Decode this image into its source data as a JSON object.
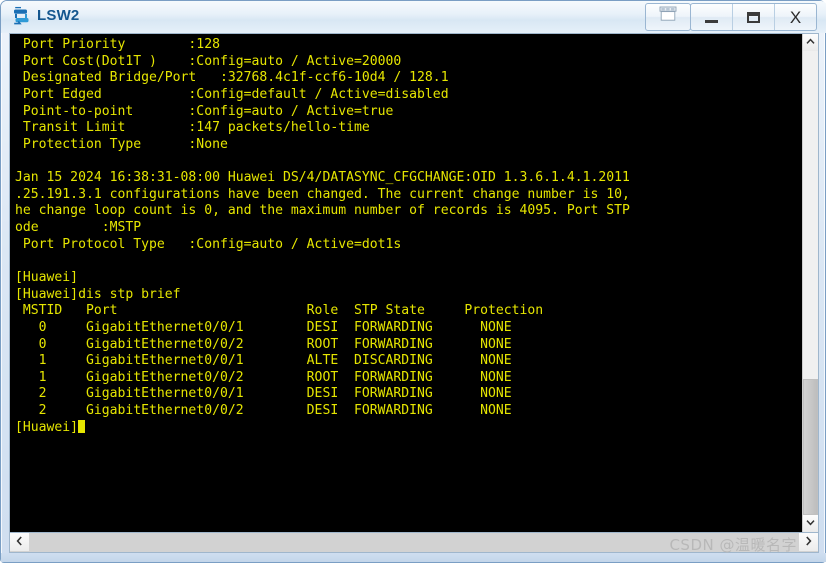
{
  "window": {
    "title": "LSW2",
    "app_icon": "switch-icon",
    "buttons": {
      "extra": {
        "label": "",
        "icon": "restore-windows-icon"
      },
      "minimize": {
        "label": "",
        "icon": "minimize-icon"
      },
      "maximize": {
        "label": "",
        "icon": "maximize-icon"
      },
      "close": {
        "label": "X",
        "icon": "close-icon"
      }
    }
  },
  "terminal": {
    "foreground_color": "#e6e600",
    "background_color": "#000000",
    "lines": [
      " Port Priority        :128",
      " Port Cost(Dot1T )    :Config=auto / Active=20000",
      " Designated Bridge/Port   :32768.4c1f-ccf6-10d4 / 128.1",
      " Port Edged           :Config=default / Active=disabled",
      " Point-to-point       :Config=auto / Active=true",
      " Transit Limit        :147 packets/hello-time",
      " Protection Type      :None",
      "",
      "Jan 15 2024 16:38:31-08:00 Huawei DS/4/DATASYNC_CFGCHANGE:OID 1.3.6.1.4.1.2011",
      ".25.191.3.1 configurations have been changed. The current change number is 10,",
      "he change loop count is 0, and the maximum number of records is 4095. Port STP",
      "ode        :MSTP",
      " Port Protocol Type   :Config=auto / Active=dot1s",
      "",
      "[Huawei]",
      "[Huawei]dis stp brief",
      " MSTID   Port                        Role  STP State     Protection",
      "   0     GigabitEthernet0/0/1        DESI  FORWARDING      NONE",
      "   0     GigabitEthernet0/0/2        ROOT  FORWARDING      NONE",
      "   1     GigabitEthernet0/0/1        ALTE  DISCARDING      NONE",
      "   1     GigabitEthernet0/0/2        ROOT  FORWARDING      NONE",
      "   2     GigabitEthernet0/0/1        DESI  FORWARDING      NONE",
      "   2     GigabitEthernet0/0/2        DESI  FORWARDING      NONE"
    ],
    "prompt": "[Huawei]"
  },
  "stp_brief": {
    "command": "dis stp brief",
    "columns": [
      "MSTID",
      "Port",
      "Role",
      "STP State",
      "Protection"
    ],
    "rows": [
      [
        "0",
        "GigabitEthernet0/0/1",
        "DESI",
        "FORWARDING",
        "NONE"
      ],
      [
        "0",
        "GigabitEthernet0/0/2",
        "ROOT",
        "FORWARDING",
        "NONE"
      ],
      [
        "1",
        "GigabitEthernet0/0/1",
        "ALTE",
        "DISCARDING",
        "NONE"
      ],
      [
        "1",
        "GigabitEthernet0/0/2",
        "ROOT",
        "FORWARDING",
        "NONE"
      ],
      [
        "2",
        "GigabitEthernet0/0/1",
        "DESI",
        "FORWARDING",
        "NONE"
      ],
      [
        "2",
        "GigabitEthernet0/0/2",
        "DESI",
        "FORWARDING",
        "NONE"
      ]
    ]
  },
  "port_details": {
    "Port Priority": "128",
    "Port Cost(Dot1T )": "Config=auto / Active=20000",
    "Designated Bridge/Port": "32768.4c1f-ccf6-10d4 / 128.1",
    "Port Edged": "Config=default / Active=disabled",
    "Point-to-point": "Config=auto / Active=true",
    "Transit Limit": "147 packets/hello-time",
    "Protection Type": "None",
    "Port Protocol Type": "Config=auto / Active=dot1s",
    "ode": "MSTP"
  },
  "log_message": {
    "timestamp": "Jan 15 2024 16:38:31-08:00",
    "device": "Huawei",
    "module": "DS/4/DATASYNC_CFGCHANGE",
    "oid": "1.3.6.1.4.1.2011.25.191.3.1",
    "text": "configurations have been changed. The current change number is 10, he change loop count is 0, and the maximum number of records is 4095.",
    "change_number": "10",
    "loop_count": "0",
    "max_records": "4095"
  },
  "scrollbars": {
    "vertical": {
      "up_glyph": "⌃",
      "down_glyph": "⌄"
    },
    "horizontal": {
      "left_glyph": "‹",
      "right_glyph": "›"
    }
  },
  "watermark": "CSDN @温暖名字"
}
